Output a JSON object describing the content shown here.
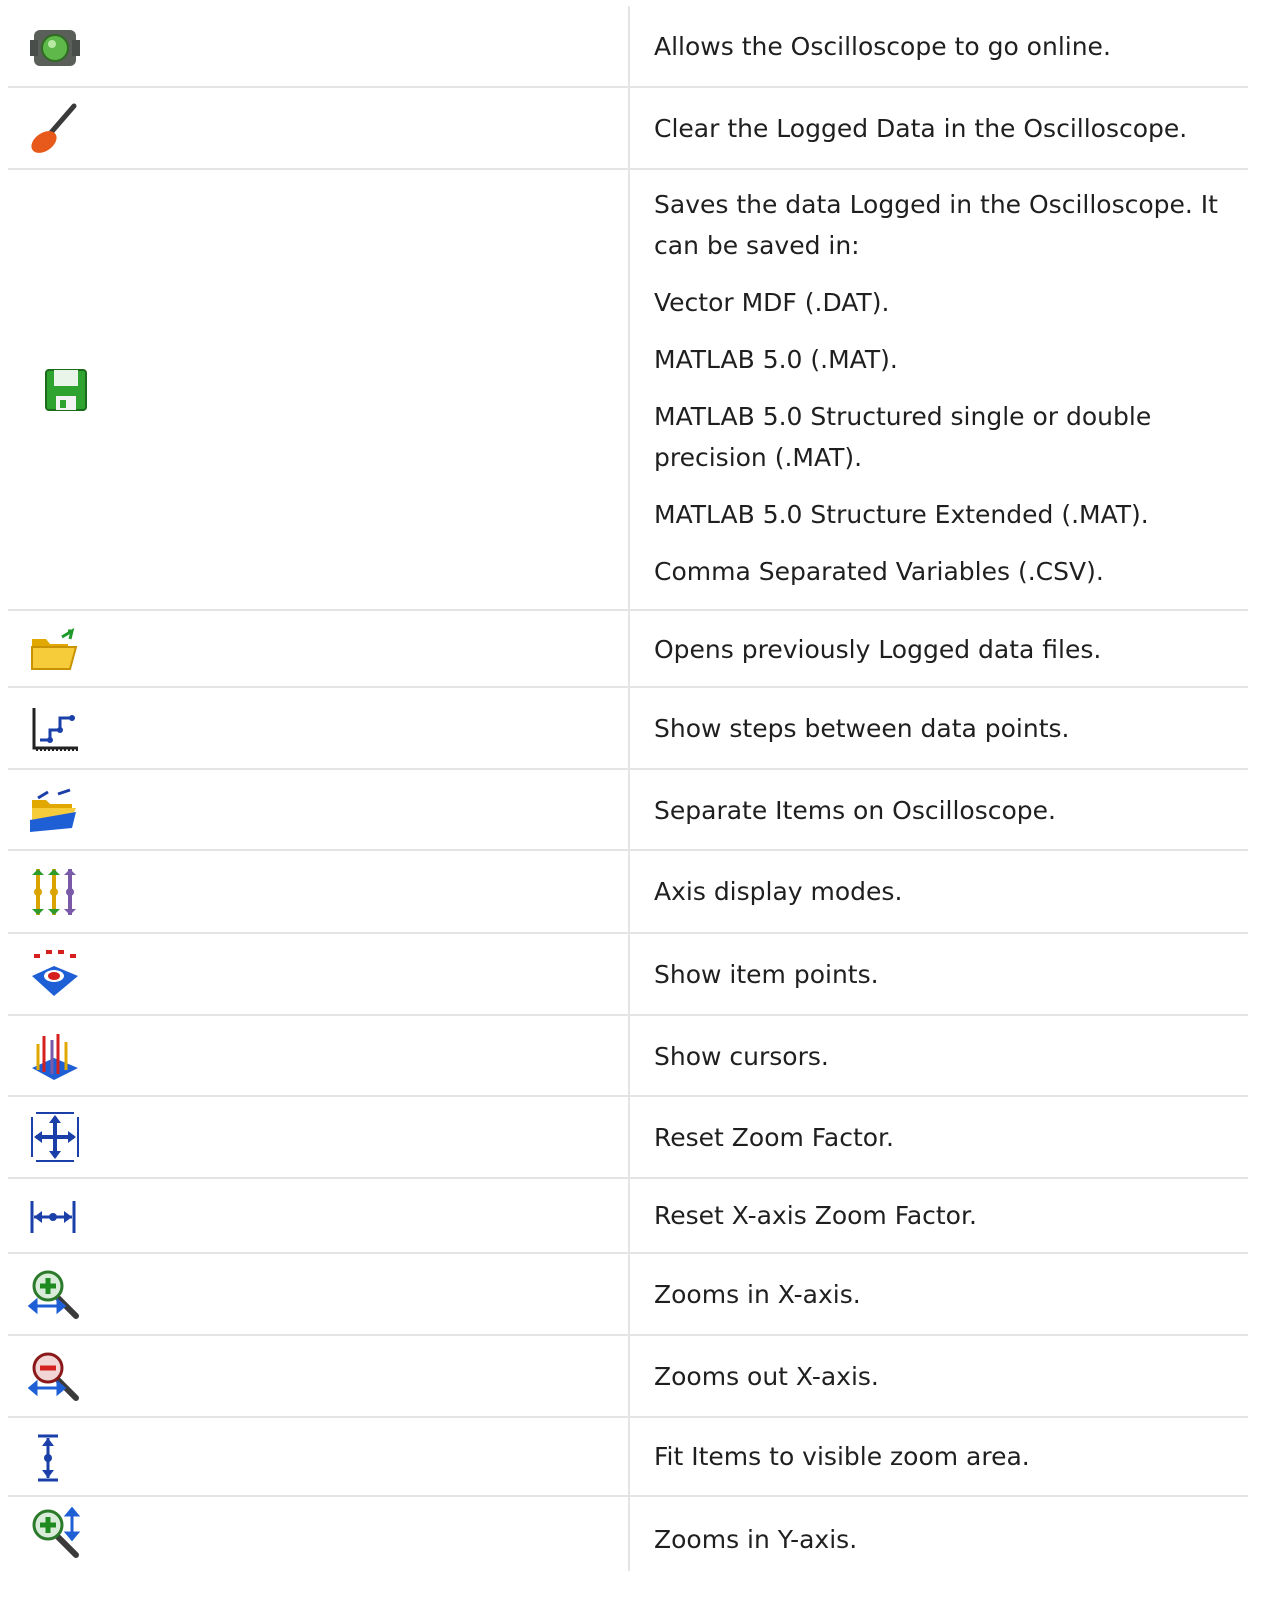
{
  "rows": [
    {
      "icon": "online-icon",
      "lines": [
        "Allows the Oscilloscope to go online."
      ]
    },
    {
      "icon": "clear-brush-icon",
      "lines": [
        "Clear the Logged Data in the Oscilloscope."
      ]
    },
    {
      "icon": "save-floppy-icon",
      "lines": [
        "Saves the data Logged in the Oscilloscope. It can be saved in:",
        "Vector MDF (.DAT).",
        "MATLAB 5.0 (.MAT).",
        "MATLAB 5.0 Structured single or double precision (.MAT).",
        "MATLAB 5.0 Structure Extended (.MAT).",
        "Comma Separated Variables (.CSV)."
      ]
    },
    {
      "icon": "open-folder-icon",
      "lines": [
        "Opens previously Logged data files."
      ]
    },
    {
      "icon": "step-plot-icon",
      "lines": [
        "Show steps between data points."
      ]
    },
    {
      "icon": "separate-items-icon",
      "lines": [
        "Separate Items on Oscilloscope."
      ]
    },
    {
      "icon": "axis-modes-icon",
      "lines": [
        "Axis display modes."
      ]
    },
    {
      "icon": "item-points-icon",
      "lines": [
        "Show item points."
      ]
    },
    {
      "icon": "cursors-icon",
      "lines": [
        "Show cursors."
      ]
    },
    {
      "icon": "reset-zoom-icon",
      "lines": [
        "Reset Zoom Factor."
      ]
    },
    {
      "icon": "reset-x-zoom-icon",
      "lines": [
        "Reset X-axis Zoom Factor."
      ]
    },
    {
      "icon": "zoom-in-x-icon",
      "lines": [
        "Zooms in X-axis."
      ]
    },
    {
      "icon": "zoom-out-x-icon",
      "lines": [
        "Zooms out X-axis."
      ]
    },
    {
      "icon": "fit-items-icon",
      "lines": [
        "Fit Items to visible zoom area."
      ]
    },
    {
      "icon": "zoom-in-y-icon",
      "lines": [
        "Zooms in Y-axis."
      ]
    }
  ]
}
